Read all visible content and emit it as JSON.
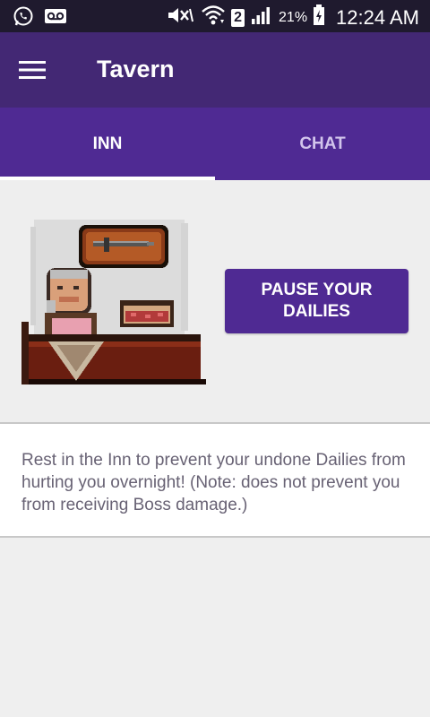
{
  "status_bar": {
    "battery_percent": "21%",
    "time": "12:24 AM",
    "sim_slot": "2",
    "icons": [
      "whatsapp-icon",
      "voicemail-icon",
      "mute-icon",
      "wifi-icon",
      "signal-icon",
      "battery-icon"
    ]
  },
  "app_bar": {
    "title": "Tavern",
    "menu_icon": "hamburger-menu-icon"
  },
  "tabs": [
    {
      "label": "INN",
      "active": true
    },
    {
      "label": "CHAT",
      "active": false
    }
  ],
  "inn": {
    "pause_button_label": "PAUSE YOUR DAILIES",
    "art_name": "innkeeper-pixel-art"
  },
  "description": {
    "text": "Rest in the Inn to prevent your undone Dailies from hurting you overnight! (Note: does not prevent you from receiving Boss damage.)"
  },
  "colors": {
    "app_bar": "#432874",
    "tabs": "#4f2a93",
    "button": "#4f2a93",
    "status_bar": "#1f1a2e",
    "background": "#efefef"
  }
}
